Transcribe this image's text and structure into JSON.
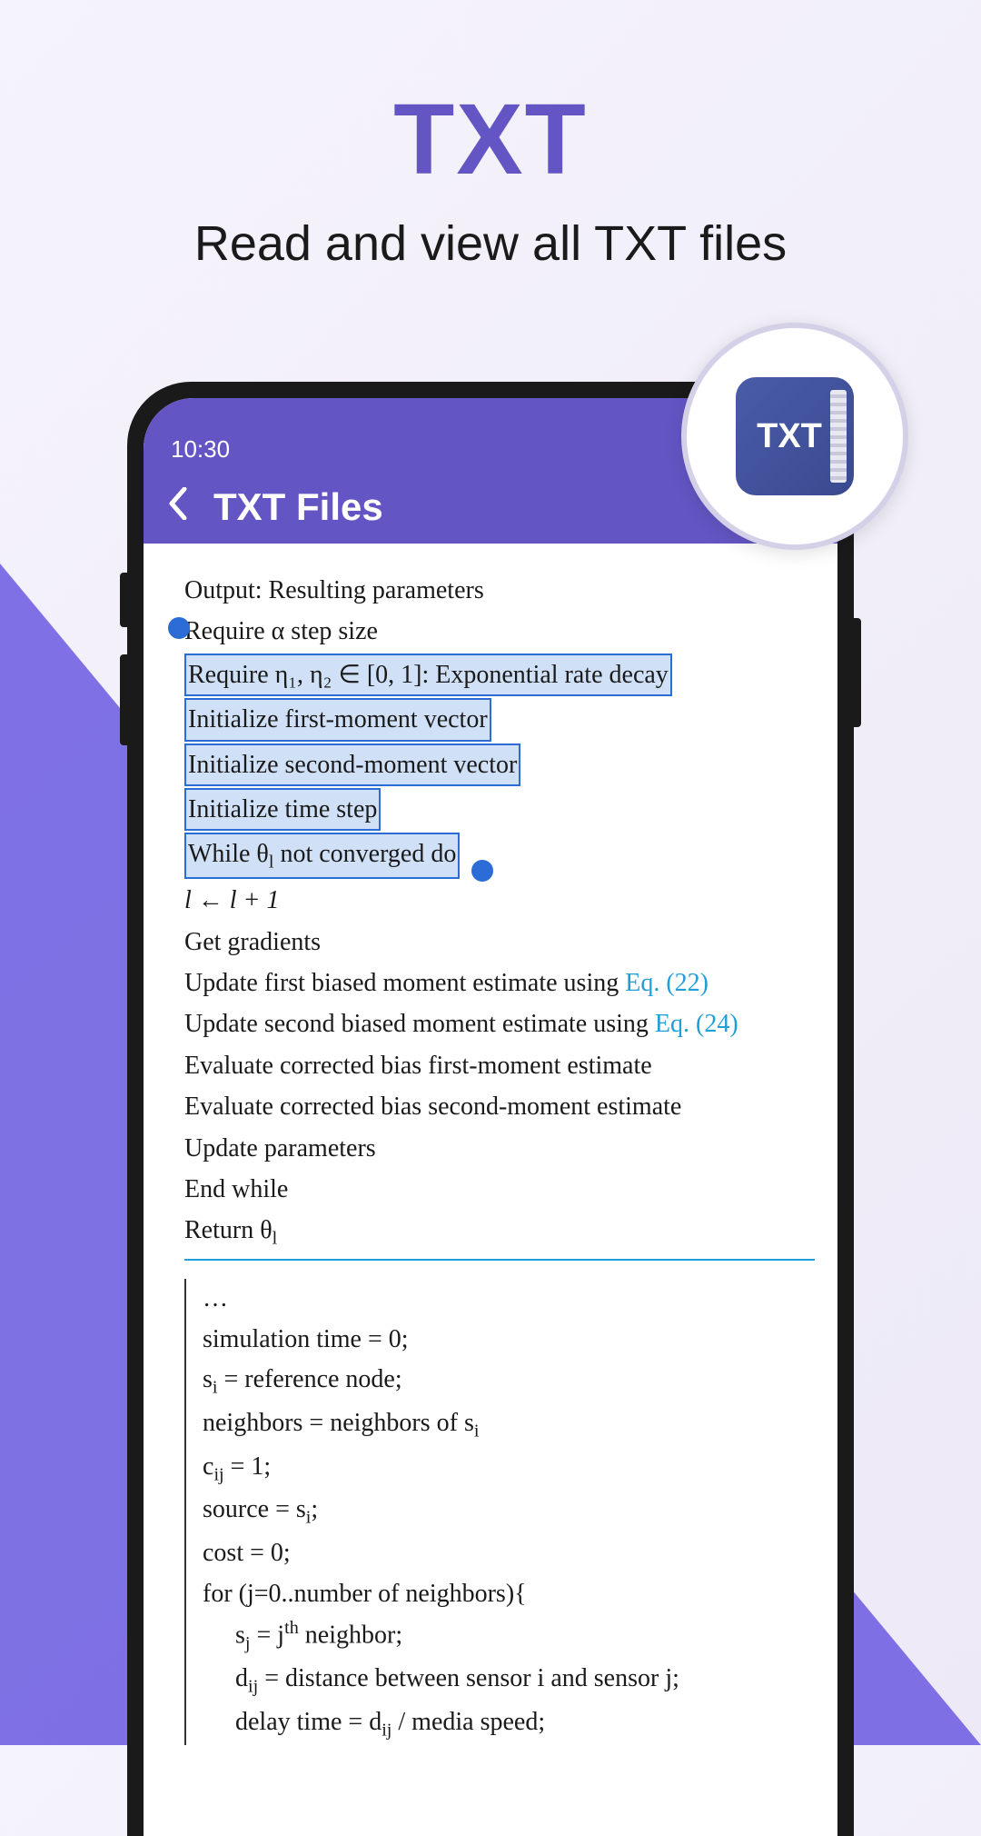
{
  "promo": {
    "title": "TXT",
    "subtitle": "Read and view all TXT files"
  },
  "icon_badge": {
    "label": "TXT"
  },
  "status_bar": {
    "time": "10:30"
  },
  "app_bar": {
    "title": "TXT Files"
  },
  "doc": {
    "l1": "Output: Resulting parameters",
    "l2": "Require α step size",
    "l3": "Require η₁, η₂ ∈ [0, 1]: Exponential rate decay",
    "l4": "Initialize first-moment vector",
    "l5": "Initialize second-moment vector",
    "l6": "Initialize time step",
    "l7a": "While θ",
    "l7b": " not converged do",
    "l8": "l ← l + 1",
    "l9": "Get gradients",
    "l10a": "Update first biased moment estimate using ",
    "l10b": "Eq. (22)",
    "l11a": "Update second biased moment estimate using ",
    "l11b": "Eq. (24)",
    "l12": "Evaluate corrected bias first-moment estimate",
    "l13": "Evaluate corrected bias second-moment estimate",
    "l14": "Update parameters",
    "l15": "End while",
    "l16a": "Return θ"
  },
  "code": {
    "c1": "…",
    "c2": "simulation time = 0;",
    "c3a": "s",
    "c3b": " = reference node;",
    "c4a": "neighbors = neighbors of s",
    "c5a": "c",
    "c5b": " = 1;",
    "c6a": "source = s",
    "c6b": ";",
    "c7": "cost = 0;",
    "c8": "for (j=0..number of neighbors){",
    "c9a": "s",
    "c9b": " = j",
    "c9c": " neighbor;",
    "c10a": "d",
    "c10b": " = distance between sensor i and sensor j;",
    "c11a": "delay time = d",
    "c11b": " / media speed;"
  },
  "sub": {
    "i": "i",
    "j": "j",
    "l": "l",
    "ij": "ij"
  },
  "sup": {
    "th": "th"
  }
}
